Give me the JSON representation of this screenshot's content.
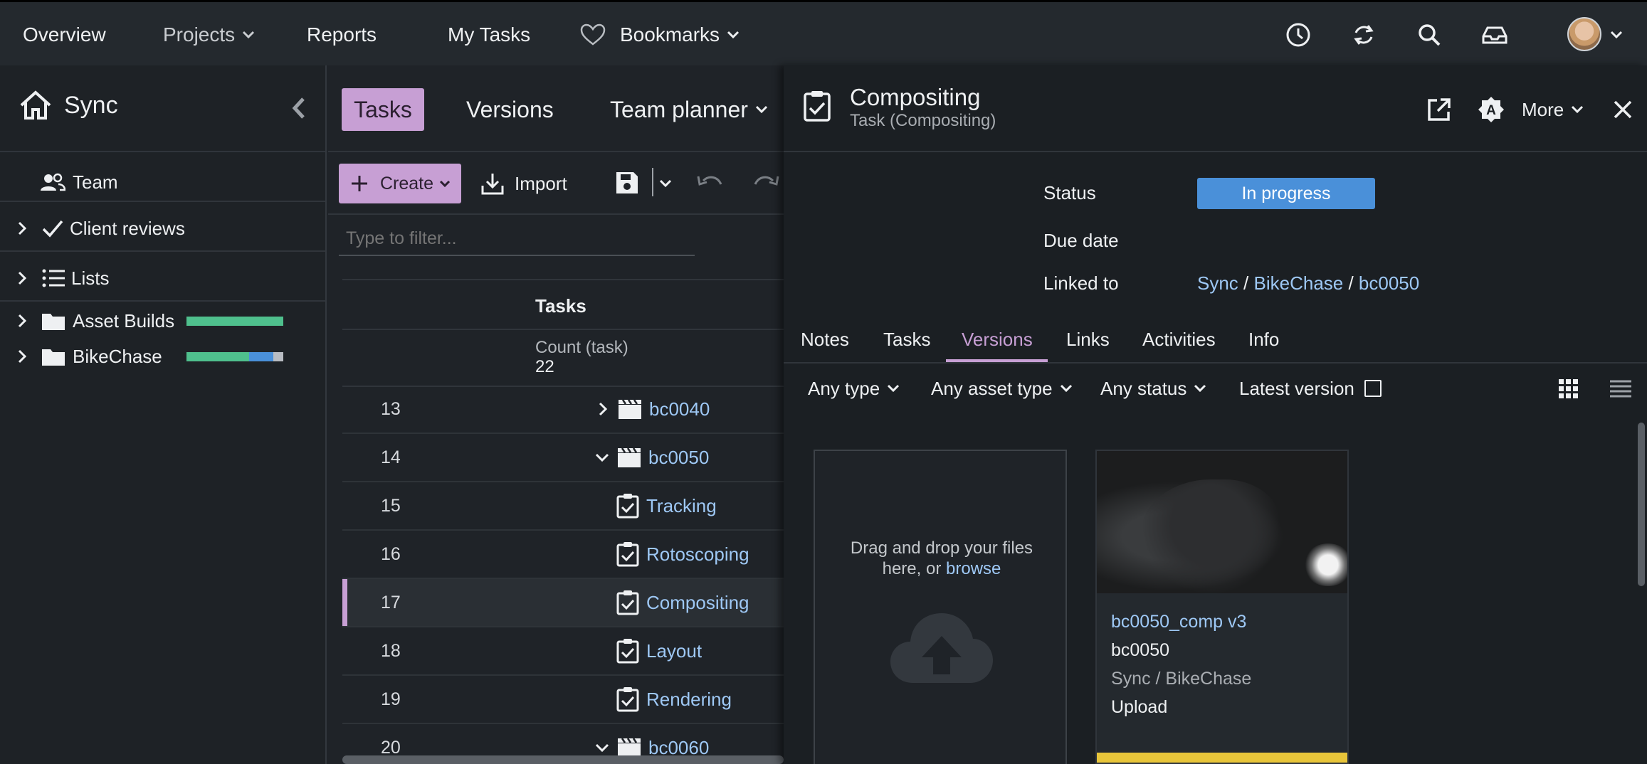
{
  "nav": {
    "overview": "Overview",
    "projects": "Projects",
    "reports": "Reports",
    "my_tasks": "My Tasks",
    "bookmarks": "Bookmarks",
    "icons": [
      "clock-icon",
      "sync-icon",
      "search-icon",
      "inbox-icon",
      "user-avatar"
    ]
  },
  "sidebar": {
    "title": "Sync",
    "items": [
      {
        "label": "Team"
      },
      {
        "label": "Client reviews"
      },
      {
        "label": "Lists"
      },
      {
        "label": "Asset Builds",
        "progress": [
          {
            "color": "#4fc08d",
            "fraction": 1.0
          }
        ]
      },
      {
        "label": "BikeChase",
        "progress": [
          {
            "color": "#4fc08d",
            "fraction": 0.65
          },
          {
            "color": "#4a90d9",
            "fraction": 0.25
          },
          {
            "color": "#b8bcc2",
            "fraction": 0.1
          }
        ]
      }
    ]
  },
  "middle": {
    "tabs": [
      "Tasks",
      "Versions",
      "Team planner"
    ],
    "create_label": "Create",
    "import_label": "Import",
    "filter_placeholder": "Type to filter...",
    "column_header": "Tasks",
    "count_label": "Count (task)",
    "count_value": "22",
    "rows": [
      {
        "num": "13",
        "name": "bc0040",
        "type": "shot",
        "expand": "collapsed"
      },
      {
        "num": "14",
        "name": "bc0050",
        "type": "shot",
        "expand": "expanded"
      },
      {
        "num": "15",
        "name": "Tracking",
        "type": "task"
      },
      {
        "num": "16",
        "name": "Rotoscoping",
        "type": "task"
      },
      {
        "num": "17",
        "name": "Compositing",
        "type": "task",
        "selected": true
      },
      {
        "num": "18",
        "name": "Layout",
        "type": "task"
      },
      {
        "num": "19",
        "name": "Rendering",
        "type": "task"
      },
      {
        "num": "20",
        "name": "bc0060",
        "type": "shot",
        "expand": "expanded"
      }
    ]
  },
  "panel": {
    "title": "Compositing",
    "subtitle": "Task (Compositing)",
    "more_label": "More",
    "status_label": "Status",
    "status_value": "In progress",
    "status_color": "#4a90d9",
    "due_label": "Due date",
    "linked_label": "Linked to",
    "linked_path": [
      "Sync",
      "BikeChase",
      "bc0050"
    ],
    "tabs": [
      "Notes",
      "Tasks",
      "Versions",
      "Links",
      "Activities",
      "Info"
    ],
    "active_tab": "Versions",
    "filters": {
      "type": "Any type",
      "asset_type": "Any asset type",
      "status": "Any status",
      "latest_version": "Latest version"
    },
    "dropzone": {
      "text": "Drag and drop your files here, or",
      "link": "browse"
    },
    "version_card": {
      "name": "bc0050_comp v3",
      "shot": "bc0050",
      "path": "Sync / BikeChase",
      "status": "Upload",
      "bar_color": "#e8c53a"
    }
  }
}
